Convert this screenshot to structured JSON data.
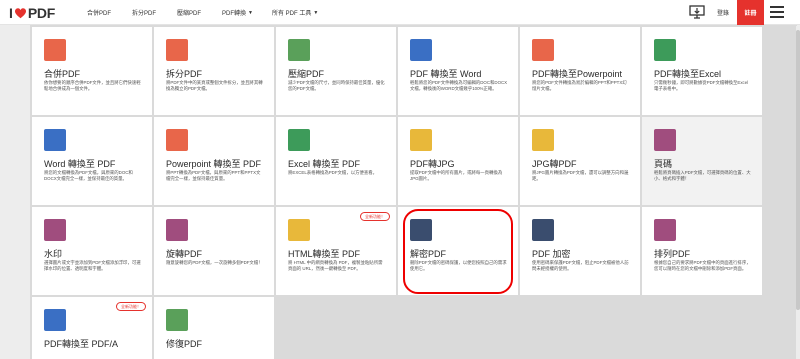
{
  "header": {
    "logo_left": "I",
    "logo_right": "PDF",
    "nav": [
      {
        "label": "合併PDF",
        "dropdown": false
      },
      {
        "label": "拆分PDF",
        "dropdown": false
      },
      {
        "label": "壓縮PDF",
        "dropdown": false
      },
      {
        "label": "PDF轉換",
        "dropdown": true
      },
      {
        "label": "所有 PDF 工具",
        "dropdown": true
      }
    ],
    "login": "登錄",
    "register": "註冊"
  },
  "tools": [
    {
      "title": "合併PDF",
      "desc": "依你想要的順序合併PDF文件，並且將它們快速輕鬆地合併成為一個文件。",
      "icon": "merge-pdf-icon",
      "color": "#e8664a",
      "badge": ""
    },
    {
      "title": "拆分PDF",
      "desc": "將PDF文件中的某頁或整個文件拆分，並且將其轉換為獨立的PDF文檔。",
      "icon": "split-pdf-icon",
      "color": "#e8664a",
      "badge": ""
    },
    {
      "title": "壓縮PDF",
      "desc": "減少PDF文檔的尺寸，並同時保持最佳質量，優化您的PDF文檔。",
      "icon": "compress-pdf-icon",
      "color": "#5aa05a",
      "badge": ""
    },
    {
      "title": "PDF 轉換至 Word",
      "desc": "輕鬆將您的PDF文件轉換為可編輯的DOC和DOCX文檔，轉換後的WORD文檔幾乎100%正確。",
      "icon": "pdf-to-word-icon",
      "color": "#3a6fc4",
      "badge": ""
    },
    {
      "title": "PDF轉換至Powerpoint",
      "desc": "將您的PDF文件轉換為易於編輯的PPT和PPTX幻燈片文檔。",
      "icon": "pdf-to-powerpoint-icon",
      "color": "#e8664a",
      "badge": ""
    },
    {
      "title": "PDF轉換至Excel",
      "desc": "只需幾秒鐘，即可將數據從PDF文檔轉換至Excel電子表格中。",
      "icon": "pdf-to-excel-icon",
      "color": "#3d9b5a",
      "badge": ""
    },
    {
      "title": "Word 轉換至 PDF",
      "desc": "將您的文檔轉換為PDF文檔，與原來的DOC和DOCX文檔完全一樣，並保持最佳的質量。",
      "icon": "word-to-pdf-icon",
      "color": "#3a6fc4",
      "badge": ""
    },
    {
      "title": "Powerpoint 轉換至 PDF",
      "desc": "將PPT轉換為PDF文檔，與原來的PPT和PPTX文檔完全一樣，並保持最佳質量。",
      "icon": "powerpoint-to-pdf-icon",
      "color": "#e8664a",
      "badge": ""
    },
    {
      "title": "Excel 轉換至 PDF",
      "desc": "將EXCEL表格轉換為PDF文檔，以方便查看。",
      "icon": "excel-to-pdf-icon",
      "color": "#3d9b5a",
      "badge": ""
    },
    {
      "title": "PDF轉JPG",
      "desc": "提取PDF文檔中的所有圖片，或將每一頁轉換為JPG圖片。",
      "icon": "pdf-to-jpg-icon",
      "color": "#e8b83a",
      "badge": ""
    },
    {
      "title": "JPG轉PDF",
      "desc": "將JPG圖片轉換為PDF文檔，還可以調整方向和邊距。",
      "icon": "jpg-to-pdf-icon",
      "color": "#e8b83a",
      "badge": ""
    },
    {
      "title": "頁碼",
      "desc": "輕鬆將頁碼插入PDF文檔，可選擇頁碼的位置、大小、格式和字體！",
      "icon": "page-numbers-icon",
      "color": "#a04d7e",
      "badge": ""
    },
    {
      "title": "水印",
      "desc": "選擇圖片或文字並添加到PDF文檔添加浮印，可選擇水印的位置、透明度和字體。",
      "icon": "watermark-icon",
      "color": "#a04d7e",
      "badge": ""
    },
    {
      "title": "旋轉PDF",
      "desc": "隨意旋轉您的PDF文檔，一次旋轉多個PDF文檔！",
      "icon": "rotate-pdf-icon",
      "color": "#a04d7e",
      "badge": ""
    },
    {
      "title": "HTML轉換至 PDF",
      "desc": "將 HTML 中的網頁轉換為 PDF，複製並粘貼所需頁面的 URL，然後一鍵轉換至 PDF。",
      "icon": "html-to-pdf-icon",
      "color": "#e8b83a",
      "badge": "全新功能！"
    },
    {
      "title": "解密PDF",
      "desc": "刪除PDF文檔的密碼保護，以便您按照自己的需求使用它。",
      "icon": "unlock-pdf-icon",
      "color": "#3a4d6e",
      "badge": ""
    },
    {
      "title": "PDF 加密",
      "desc": "使用密碼來保護PDF文檔，阻止PDF文檔被他人訪問未經授權的使用。",
      "icon": "protect-pdf-icon",
      "color": "#3a4d6e",
      "badge": ""
    },
    {
      "title": "排列PDF",
      "desc": "根據您自己的要求將PDF文檔中的頁面進行排序，您可以隨時在您的文檔中刪除和添加PDF頁面。",
      "icon": "organize-pdf-icon",
      "color": "#a04d7e",
      "badge": ""
    },
    {
      "title": "PDF轉換至 PDF/A",
      "desc": "",
      "icon": "pdf-to-pdfa-icon",
      "color": "#3a6fc4",
      "badge": "全新功能！"
    },
    {
      "title": "修復PDF",
      "desc": "",
      "icon": "repair-pdf-icon",
      "color": "#5aa05a",
      "badge": ""
    }
  ]
}
